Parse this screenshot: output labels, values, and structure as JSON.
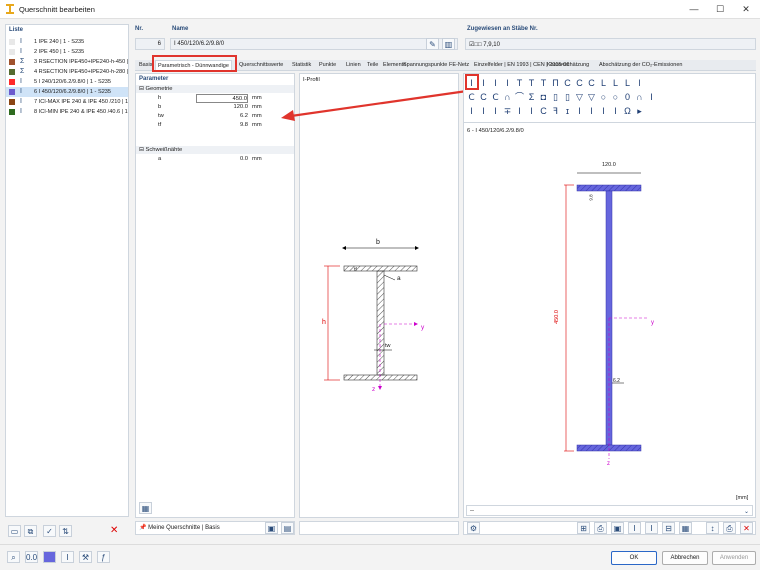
{
  "window": {
    "title": "Querschnitt bearbeiten",
    "minimize": "—",
    "maximize": "☐",
    "close": "✕"
  },
  "list": {
    "header": "Liste",
    "items": [
      {
        "label": "1 IPE 240 | 1 - S235",
        "color": "#e8e8e8",
        "icon": "I"
      },
      {
        "label": "2 IPE 450 | 1 - S235",
        "color": "#e8e8e8",
        "icon": "I"
      },
      {
        "label": "3 RSECTION IPE450+IPE240-h-450 | 1",
        "color": "#a0522d",
        "icon": "Σ"
      },
      {
        "label": "4 RSECTION IPE450+IPE240-h-280 | 1",
        "color": "#556b2f",
        "icon": "Σ"
      },
      {
        "label": "5 I 240/120/6.2/9.8/0 | 1 - S235",
        "color": "#ff2a2a",
        "icon": "I"
      },
      {
        "label": "6 I 450/120/6.2/9.8/0 | 1 - S235",
        "color": "#6a5acd",
        "icon": "I"
      },
      {
        "label": "7 ICI-MAX IPE 240 & IPE 450 /210 | 1 -",
        "color": "#8b4513",
        "icon": "I"
      },
      {
        "label": "8 ICI-MIN IPE 240 & IPE 450 /40.6 | 1 -",
        "color": "#2e6b1f",
        "icon": "I"
      }
    ]
  },
  "nr": {
    "label": "Nr.",
    "value": "6"
  },
  "name": {
    "label": "Name",
    "value": "I 450/120/6.2/9.8/0"
  },
  "assigned": {
    "label": "Zugewiesen an Stäbe Nr.",
    "value": "☑□□ 7,9,10"
  },
  "tabs": [
    "Basis",
    "Parametrisch - Dünnwandige",
    "Querschnittswerte",
    "Statistik",
    "Punkte",
    "Linien",
    "Teile",
    "Elemente",
    "Spannungspunkte",
    "FE-Netz",
    "Einzelfelder | EN 1993 | CEN | 2015-06",
    "Kostenschätzung",
    "Abschätzung der CO₂-Emissionen"
  ],
  "params": {
    "header": "Parameter",
    "group_geometry": "Geometrie",
    "group_welds": "Schweißnähte",
    "rows": [
      {
        "name": "h",
        "value": "450.0",
        "unit": "mm"
      },
      {
        "name": "b",
        "value": "120.0",
        "unit": "mm"
      },
      {
        "name": "tw",
        "value": "6.2",
        "unit": "mm"
      },
      {
        "name": "tf",
        "value": "9.8",
        "unit": "mm"
      }
    ],
    "weld": {
      "name": "a",
      "value": "0.0",
      "unit": "mm"
    }
  },
  "iprofil": {
    "label": "I-Profil",
    "b": "b",
    "tf": "tf",
    "a": "a",
    "h": "h",
    "tw": "tw",
    "y": "y",
    "z": "z"
  },
  "preview": {
    "title": "6 - I 450/120/6.2/9.8/0",
    "width": "120.0",
    "tf": "9.8",
    "height": "450.0",
    "tw": "6.2",
    "y": "y",
    "z": "z",
    "unit": "[mm]"
  },
  "shapes_row1": [
    "I",
    "I",
    "I",
    "I",
    "T",
    "T",
    "T",
    "П",
    "C",
    "C",
    "C",
    "L",
    "L",
    "L",
    "l"
  ],
  "shapes_row2": [
    "Ⅽ",
    "С",
    "Ⅽ",
    "∩",
    "⌒",
    "Σ",
    "◘",
    "▯",
    "▯",
    "▽",
    "▽",
    "○",
    "○",
    "0",
    "∩",
    "I"
  ],
  "shapes_row3": [
    "I",
    "I",
    "I",
    "∓",
    "I",
    "I",
    "C",
    "ꟻ",
    "ɪ",
    "I",
    "I",
    "I",
    "I",
    "Ω",
    "▸"
  ],
  "bottom": {
    "library": "Meine Querschnitte | Basis",
    "dropdown_preview": "--",
    "ok": "OK",
    "cancel": "Abbrechen",
    "apply": "Anwenden"
  },
  "colors": {
    "accent": "#2a4c7a",
    "section": "#6666dd",
    "highlight": "#e0342c"
  }
}
